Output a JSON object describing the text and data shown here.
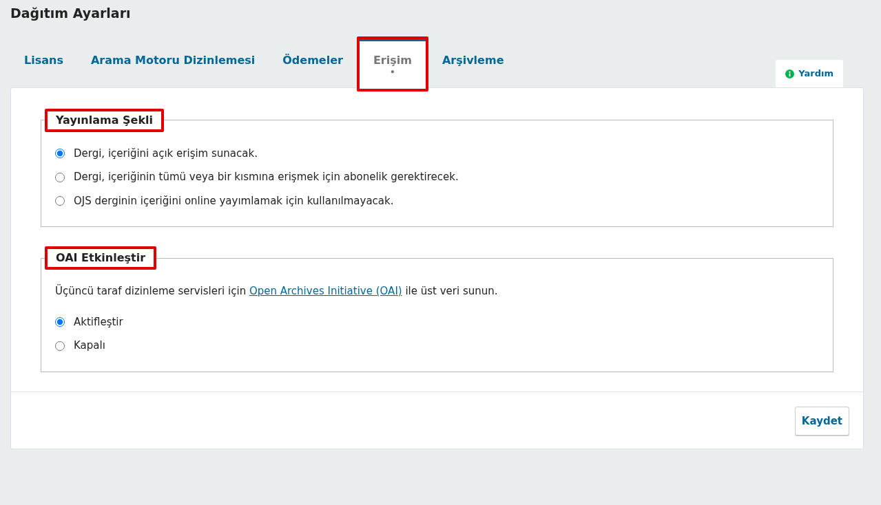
{
  "page_title": "Dağıtım Ayarları",
  "tabs": [
    {
      "label": "Lisans",
      "selected": false,
      "highlighted": false
    },
    {
      "label": "Arama Motoru Dizinlemesi",
      "selected": false,
      "highlighted": false
    },
    {
      "label": "Ödemeler",
      "selected": false,
      "highlighted": false
    },
    {
      "label": "Erişim",
      "selected": true,
      "highlighted": true,
      "marker": "•"
    },
    {
      "label": "Arşivleme",
      "selected": false,
      "highlighted": false
    }
  ],
  "help_button": {
    "label": "Yardım"
  },
  "sections": [
    {
      "legend": "Yayınlama Şekli",
      "highlighted": true,
      "options": [
        {
          "label": "Dergi, içeriğini açık erişim sunacak.",
          "selected": true
        },
        {
          "label": "Dergi, içeriğinin tümü veya bir kısmına erişmek için abonelik gerektirecek.",
          "selected": false
        },
        {
          "label": "OJS derginin içeriğini online yayımlamak için kullanılmayacak.",
          "selected": false
        }
      ]
    },
    {
      "legend": "OAI Etkinleştir",
      "highlighted": true,
      "description": "Üçüncü taraf dizinleme servisleri için",
      "link": "Open Archives Initiative (OAI)",
      "description_end": "ile üst veri sunun.",
      "options": [
        {
          "label": "Aktifleştir",
          "selected": true
        },
        {
          "label": "Kapalı",
          "selected": false
        }
      ]
    }
  ],
  "save_button": {
    "label": "Kaydet"
  }
}
